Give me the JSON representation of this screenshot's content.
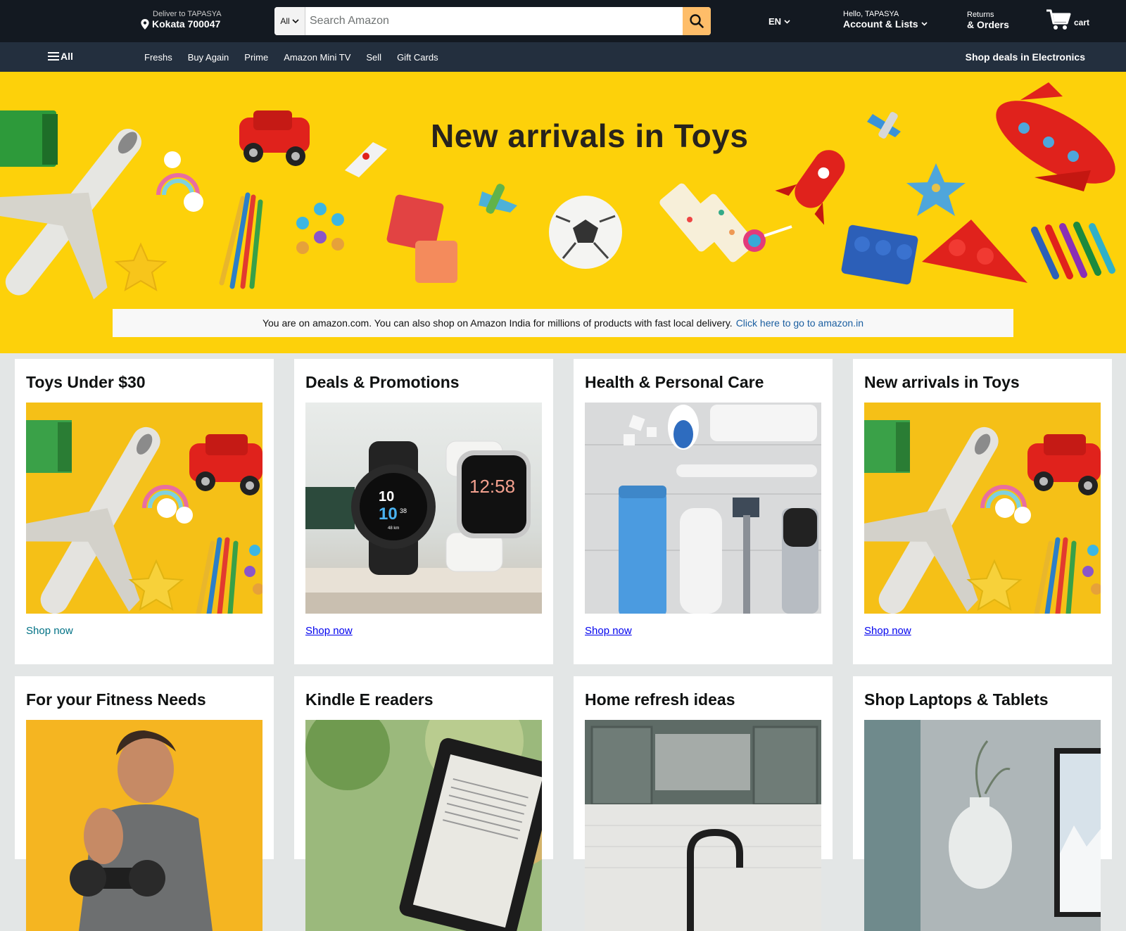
{
  "header": {
    "deliver_line1": "Deliver to TAPASYA",
    "deliver_line2": "Kokata 700047",
    "search_category": "All",
    "search_placeholder": "Search Amazon",
    "language": "EN",
    "account_line1": "Hello, TAPASYA",
    "account_line2": "Account & Lists",
    "returns_line1": "Returns",
    "returns_line2": "& Orders",
    "cart_label": "cart"
  },
  "subnav": {
    "all_label": "All",
    "links": [
      "Freshs",
      "Buy Again",
      "Prime",
      "Amazon Mini TV",
      "Sell",
      "Gift Cards"
    ],
    "deals_label": "Shop deals in Electronics"
  },
  "hero": {
    "title": "New arrivals in Toys",
    "notice_text": "You are on amazon.com. You can also shop on Amazon India for millions of products with fast local delivery.",
    "notice_link": "Click here to go to amazon.in"
  },
  "cards": [
    {
      "title": "Toys Under $30",
      "link": "Shop now"
    },
    {
      "title": "Deals & Promotions",
      "link": "Shop now"
    },
    {
      "title": "Health & Personal Care",
      "link": "Shop now"
    },
    {
      "title": "New arrivals in Toys",
      "link": "Shop now"
    },
    {
      "title": "For your Fitness Needs"
    },
    {
      "title": "Kindle E readers"
    },
    {
      "title": "Home refresh ideas"
    },
    {
      "title": "Shop Laptops & Tablets"
    }
  ],
  "watch_faces": {
    "left_hour": "10",
    "left_min": "10",
    "left_sec": "38",
    "left_dist": "48 km",
    "right_time": "12:58"
  },
  "colors": {
    "nav_dark": "#131921",
    "nav_secondary": "#232f3e",
    "search_button": "#febd69",
    "hero_yellow": "#fdd10a",
    "link_teal": "#007185"
  }
}
